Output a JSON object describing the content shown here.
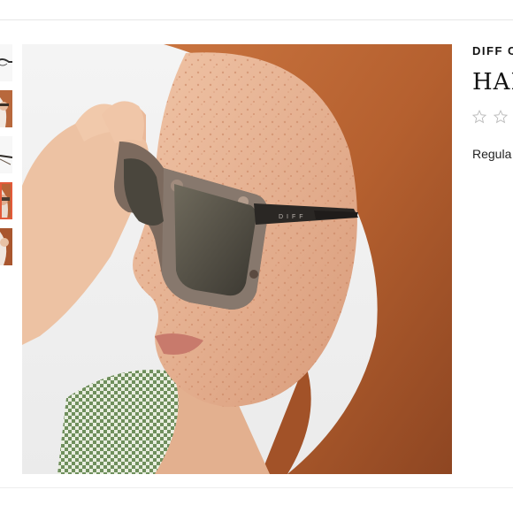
{
  "product": {
    "brand": "DIFF C",
    "title": "HAI",
    "rating": {
      "max": 5,
      "filled": 0
    },
    "price_label": "Regula"
  },
  "gallery": {
    "thumbnail_count": 5,
    "active_index": 3,
    "main_image_alt": "Woman with red hair wearing tortoise DIFF sunglasses",
    "temple_text": "DIFF",
    "accent_color": "#e35a3a"
  }
}
